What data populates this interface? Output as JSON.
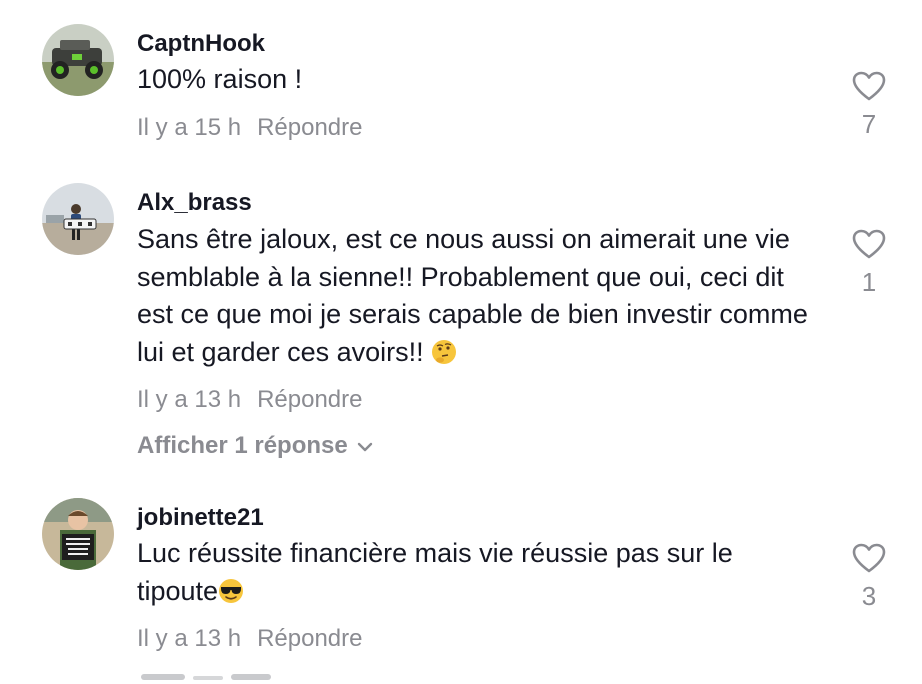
{
  "comments": [
    {
      "username": "CaptnHook",
      "text": "100% raison !",
      "time": "Il y a 15 h",
      "reply_label": "Répondre",
      "likes": "7",
      "avatar_icon": "offroad-vehicle-photo"
    },
    {
      "username": "Alx_brass",
      "text": "Sans être jaloux, est ce nous aussi on aimerait une vie semblable à la sienne!! Probablement que oui, ceci dit est ce que moi je serais capable de bien investir comme lui et garder ces avoirs!! ",
      "emoji": "thinking-face-emoji",
      "time": "Il y a 13 h",
      "reply_label": "Répondre",
      "likes": "1",
      "view_replies": "Afficher 1 réponse",
      "avatar_icon": "beach-person-photo"
    },
    {
      "username": "jobinette21",
      "text_line1": "Luc réussite financière mais vie réussie pas sur le",
      "text_line2": "tipoute",
      "emoji": "sunglasses-face-emoji",
      "time": "Il y a 13 h",
      "reply_label": "Répondre",
      "likes": "3",
      "avatar_icon": "child-school-sign-photo"
    }
  ],
  "colors": {
    "text": "#161823",
    "muted": "#8a8b91",
    "background": "#ffffff"
  }
}
